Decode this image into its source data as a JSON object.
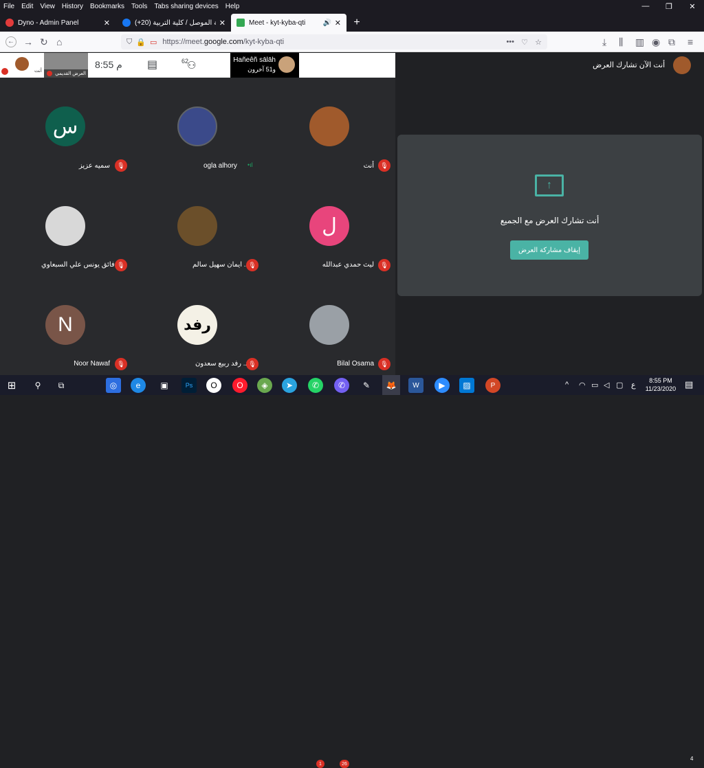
{
  "menu": [
    "File",
    "Edit",
    "View",
    "History",
    "Bookmarks",
    "Tools",
    "Tabs sharing devices",
    "Help"
  ],
  "window_controls": {
    "minimize": "—",
    "restore": "❐",
    "close": "✕"
  },
  "tabs": [
    {
      "title": "Dyno - Admin Panel",
      "close": "✕",
      "color": "#e23b3b"
    },
    {
      "title": "(+20) جامعة الموصل / كلية التربية",
      "close": "✕",
      "color": "#1877f2"
    },
    {
      "title": "Meet - kyt-kyba-qti",
      "close": "✕",
      "color": "#34a853",
      "audio": "🔊"
    }
  ],
  "new_tab": "+",
  "url": {
    "scheme": "https://meet.",
    "host": "google.com",
    "path": "/kyt-kyba-qti"
  },
  "meet_top": {
    "time": "8:55",
    "time_suffix": "م",
    "participants_count": "62",
    "presenter_name": "Hañeêñ sālāh",
    "presenter_others": "و51 آخرون",
    "self_tile_label": "العرض القديمي",
    "self_label": "أنت",
    "sharing_banner": "أنت الآن تشارك العرض"
  },
  "participants": [
    {
      "name": "سميه عزيز",
      "initial": "س",
      "bg": "#0f5f4d",
      "muted": true
    },
    {
      "name": "ogla alhory",
      "initial": "",
      "bg": "#3b4a8a",
      "muted": false,
      "speaking": "•ıl"
    },
    {
      "name": "أنت",
      "initial": "",
      "bg": "#a05a2c",
      "muted": true
    },
    {
      "name": "فائق يونس علي السبعاوي",
      "initial": "",
      "bg": "#d8d8d8",
      "muted": true
    },
    {
      "name": "د. ايمان سهيل سالم",
      "initial": "",
      "bg": "#6b4f2a",
      "muted": true
    },
    {
      "name": "ليث حمدي عبدالله",
      "initial": "ل",
      "bg": "#e8457c",
      "muted": true
    },
    {
      "name": "Noor Nawaf",
      "initial": "N",
      "bg": "#795548",
      "muted": true
    },
    {
      "name": "د. رفد ربيع سعدون",
      "initial": "رفد",
      "bg": "#f4f1e6",
      "muted": true
    },
    {
      "name": "Bilal Osama",
      "initial": "",
      "bg": "#9aa0a6",
      "muted": true
    }
  ],
  "share_panel": {
    "title": "أنت تشارك العرض مع الجميع",
    "stop_button": "إيقاف مشاركة العرض"
  },
  "taskbar": {
    "time": "8:55 PM",
    "date": "11/23/2020",
    "lang": "ع",
    "notif_count": "4",
    "badges": {
      "whatsapp": "1",
      "viber": "26"
    }
  }
}
